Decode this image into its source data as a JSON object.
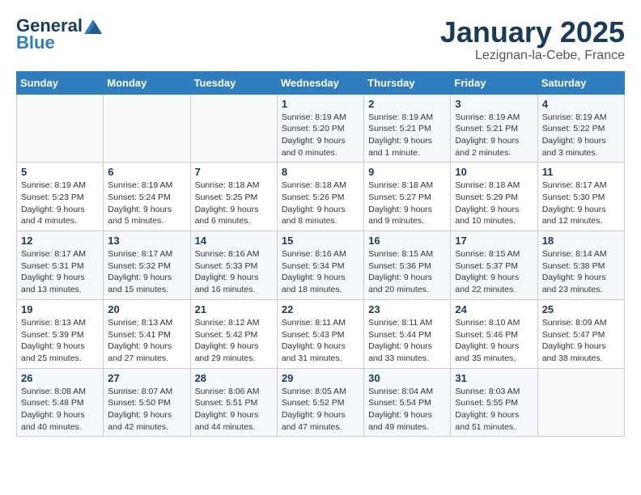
{
  "header": {
    "logo_line1": "General",
    "logo_line2": "Blue",
    "month_title": "January 2025",
    "location": "Lezignan-la-Cebe, France"
  },
  "days_of_week": [
    "Sunday",
    "Monday",
    "Tuesday",
    "Wednesday",
    "Thursday",
    "Friday",
    "Saturday"
  ],
  "weeks": [
    [
      {
        "num": "",
        "info": ""
      },
      {
        "num": "",
        "info": ""
      },
      {
        "num": "",
        "info": ""
      },
      {
        "num": "1",
        "info": "Sunrise: 8:19 AM\nSunset: 5:20 PM\nDaylight: 9 hours\nand 0 minutes."
      },
      {
        "num": "2",
        "info": "Sunrise: 8:19 AM\nSunset: 5:21 PM\nDaylight: 9 hours\nand 1 minute."
      },
      {
        "num": "3",
        "info": "Sunrise: 8:19 AM\nSunset: 5:21 PM\nDaylight: 9 hours\nand 2 minutes."
      },
      {
        "num": "4",
        "info": "Sunrise: 8:19 AM\nSunset: 5:22 PM\nDaylight: 9 hours\nand 3 minutes."
      }
    ],
    [
      {
        "num": "5",
        "info": "Sunrise: 8:19 AM\nSunset: 5:23 PM\nDaylight: 9 hours\nand 4 minutes."
      },
      {
        "num": "6",
        "info": "Sunrise: 8:19 AM\nSunset: 5:24 PM\nDaylight: 9 hours\nand 5 minutes."
      },
      {
        "num": "7",
        "info": "Sunrise: 8:18 AM\nSunset: 5:25 PM\nDaylight: 9 hours\nand 6 minutes."
      },
      {
        "num": "8",
        "info": "Sunrise: 8:18 AM\nSunset: 5:26 PM\nDaylight: 9 hours\nand 8 minutes."
      },
      {
        "num": "9",
        "info": "Sunrise: 8:18 AM\nSunset: 5:27 PM\nDaylight: 9 hours\nand 9 minutes."
      },
      {
        "num": "10",
        "info": "Sunrise: 8:18 AM\nSunset: 5:29 PM\nDaylight: 9 hours\nand 10 minutes."
      },
      {
        "num": "11",
        "info": "Sunrise: 8:17 AM\nSunset: 5:30 PM\nDaylight: 9 hours\nand 12 minutes."
      }
    ],
    [
      {
        "num": "12",
        "info": "Sunrise: 8:17 AM\nSunset: 5:31 PM\nDaylight: 9 hours\nand 13 minutes."
      },
      {
        "num": "13",
        "info": "Sunrise: 8:17 AM\nSunset: 5:32 PM\nDaylight: 9 hours\nand 15 minutes."
      },
      {
        "num": "14",
        "info": "Sunrise: 8:16 AM\nSunset: 5:33 PM\nDaylight: 9 hours\nand 16 minutes."
      },
      {
        "num": "15",
        "info": "Sunrise: 8:16 AM\nSunset: 5:34 PM\nDaylight: 9 hours\nand 18 minutes."
      },
      {
        "num": "16",
        "info": "Sunrise: 8:15 AM\nSunset: 5:36 PM\nDaylight: 9 hours\nand 20 minutes."
      },
      {
        "num": "17",
        "info": "Sunrise: 8:15 AM\nSunset: 5:37 PM\nDaylight: 9 hours\nand 22 minutes."
      },
      {
        "num": "18",
        "info": "Sunrise: 8:14 AM\nSunset: 5:38 PM\nDaylight: 9 hours\nand 23 minutes."
      }
    ],
    [
      {
        "num": "19",
        "info": "Sunrise: 8:13 AM\nSunset: 5:39 PM\nDaylight: 9 hours\nand 25 minutes."
      },
      {
        "num": "20",
        "info": "Sunrise: 8:13 AM\nSunset: 5:41 PM\nDaylight: 9 hours\nand 27 minutes."
      },
      {
        "num": "21",
        "info": "Sunrise: 8:12 AM\nSunset: 5:42 PM\nDaylight: 9 hours\nand 29 minutes."
      },
      {
        "num": "22",
        "info": "Sunrise: 8:11 AM\nSunset: 5:43 PM\nDaylight: 9 hours\nand 31 minutes."
      },
      {
        "num": "23",
        "info": "Sunrise: 8:11 AM\nSunset: 5:44 PM\nDaylight: 9 hours\nand 33 minutes."
      },
      {
        "num": "24",
        "info": "Sunrise: 8:10 AM\nSunset: 5:46 PM\nDaylight: 9 hours\nand 35 minutes."
      },
      {
        "num": "25",
        "info": "Sunrise: 8:09 AM\nSunset: 5:47 PM\nDaylight: 9 hours\nand 38 minutes."
      }
    ],
    [
      {
        "num": "26",
        "info": "Sunrise: 8:08 AM\nSunset: 5:48 PM\nDaylight: 9 hours\nand 40 minutes."
      },
      {
        "num": "27",
        "info": "Sunrise: 8:07 AM\nSunset: 5:50 PM\nDaylight: 9 hours\nand 42 minutes."
      },
      {
        "num": "28",
        "info": "Sunrise: 8:06 AM\nSunset: 5:51 PM\nDaylight: 9 hours\nand 44 minutes."
      },
      {
        "num": "29",
        "info": "Sunrise: 8:05 AM\nSunset: 5:52 PM\nDaylight: 9 hours\nand 47 minutes."
      },
      {
        "num": "30",
        "info": "Sunrise: 8:04 AM\nSunset: 5:54 PM\nDaylight: 9 hours\nand 49 minutes."
      },
      {
        "num": "31",
        "info": "Sunrise: 8:03 AM\nSunset: 5:55 PM\nDaylight: 9 hours\nand 51 minutes."
      },
      {
        "num": "",
        "info": ""
      }
    ]
  ]
}
